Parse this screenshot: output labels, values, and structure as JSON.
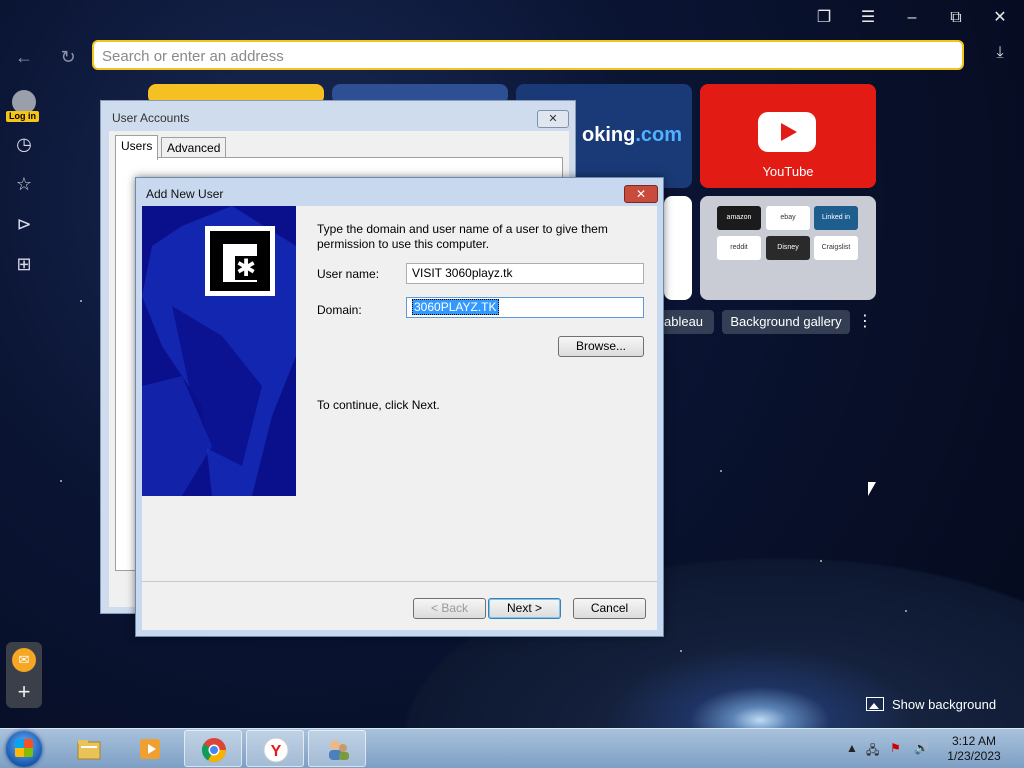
{
  "browser": {
    "address_placeholder": "Search or enter an address",
    "login_label": "Log in",
    "window_controls": [
      "bookmarks-icon",
      "menu-icon",
      "minimize-icon",
      "restore-icon",
      "close-icon"
    ]
  },
  "tiles": {
    "booking_label": "oking",
    "booking_suffix": ".com",
    "youtube_label": "YouTube",
    "mini": [
      "amazon",
      "ebay",
      "Linked in",
      "reddit",
      "Disney",
      "Craigslist"
    ]
  },
  "gallery": {
    "tableau_label": "ableau",
    "background_gallery_label": "Background gallery",
    "more_label": "⋮",
    "show_background_label": "Show background"
  },
  "user_accounts": {
    "title": "User Accounts",
    "close_label": "✕",
    "tabs": [
      "Users",
      "Advanced"
    ]
  },
  "add_user": {
    "title": "Add New User",
    "close_label": "✕",
    "instruction": "Type the domain and user name of a user to give them permission to use this computer.",
    "username_label": "User name:",
    "username_value": "VISIT 3060playz.tk",
    "domain_label": "Domain:",
    "domain_value": "3060PLAYZ.TK",
    "browse_label": "Browse...",
    "continue_text": "To continue, click Next.",
    "back_label": "< Back",
    "next_label": "Next >",
    "cancel_label": "Cancel"
  },
  "taskbar": {
    "apps": [
      "file-explorer-icon",
      "media-player-icon",
      "chrome-icon",
      "yandex-icon",
      "user-accounts-icon"
    ],
    "time": "3:12 AM",
    "date": "1/23/2023"
  },
  "colors": {
    "accent_yellow": "#f2c41c",
    "youtube_red": "#e21b15",
    "booking_blue": "#1a3a77",
    "selection_blue": "#3399ff"
  }
}
